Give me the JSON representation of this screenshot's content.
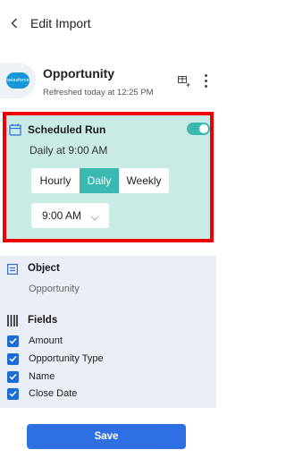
{
  "header": {
    "title": "Edit Import"
  },
  "source": {
    "logo_text": "salesforce",
    "name": "Opportunity",
    "refreshed": "Refreshed today at 12:25 PM"
  },
  "schedule": {
    "title": "Scheduled Run",
    "enabled": true,
    "summary": "Daily at 9:00 AM",
    "frequency_options": [
      "Hourly",
      "Daily",
      "Weekly"
    ],
    "selected_frequency": "Daily",
    "time": "9:00 AM"
  },
  "object": {
    "title": "Object",
    "value": "Opportunity"
  },
  "fields": {
    "title": "Fields",
    "items": [
      {
        "label": "Amount",
        "checked": true
      },
      {
        "label": "Opportunity Type",
        "checked": true
      },
      {
        "label": "Name",
        "checked": true
      },
      {
        "label": "Close Date",
        "checked": true
      }
    ]
  },
  "footer": {
    "save_label": "Save"
  },
  "colors": {
    "accent": "#3bb8b2",
    "primary": "#2f6fe4",
    "highlight_border": "#ee0000"
  }
}
